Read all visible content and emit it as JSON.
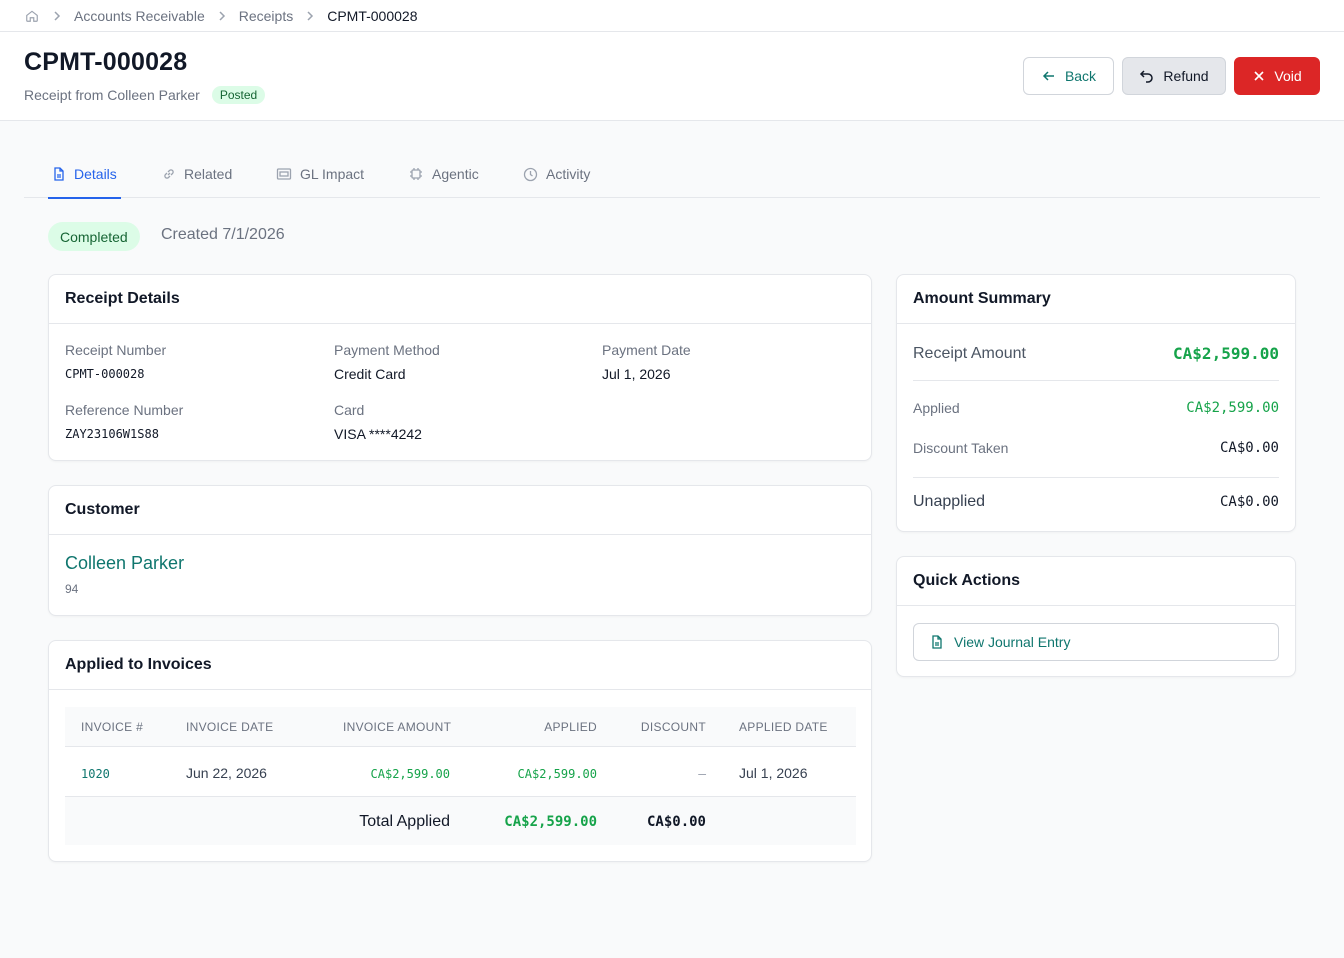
{
  "breadcrumb": {
    "items": [
      "Accounts Receivable",
      "Receipts"
    ],
    "current": "CPMT-000028"
  },
  "header": {
    "title": "CPMT-000028",
    "subtitle": "Receipt from Colleen Parker",
    "badge": "Posted",
    "back_label": "Back",
    "refund_label": "Refund",
    "void_label": "Void"
  },
  "tabs": [
    {
      "label": "Details",
      "icon": "document-icon",
      "active": true
    },
    {
      "label": "Related",
      "icon": "link-icon"
    },
    {
      "label": "GL Impact",
      "icon": "ledger-icon"
    },
    {
      "label": "Agentic",
      "icon": "chip-icon"
    },
    {
      "label": "Activity",
      "icon": "clock-icon"
    }
  ],
  "status": {
    "pill": "Completed",
    "created": "Created 7/1/2026"
  },
  "receipt_details": {
    "title": "Receipt Details",
    "receipt_number_label": "Receipt Number",
    "receipt_number": "CPMT-000028",
    "payment_method_label": "Payment Method",
    "payment_method": "Credit Card",
    "payment_date_label": "Payment Date",
    "payment_date": "Jul 1, 2026",
    "reference_number_label": "Reference Number",
    "reference_number": "ZAY23106W1S88",
    "card_label": "Card",
    "card": "VISA ****4242"
  },
  "customer": {
    "title": "Customer",
    "name": "Colleen Parker",
    "id": "94"
  },
  "applied": {
    "title": "Applied to Invoices",
    "columns": [
      "INVOICE #",
      "INVOICE DATE",
      "INVOICE AMOUNT",
      "APPLIED",
      "DISCOUNT",
      "APPLIED DATE"
    ],
    "rows": [
      {
        "invoice": "1020",
        "invoice_date": "Jun 22, 2026",
        "invoice_amount": "CA$2,599.00",
        "applied": "CA$2,599.00",
        "discount": "–",
        "applied_date": "Jul 1, 2026"
      }
    ],
    "total_label": "Total Applied",
    "total_applied": "CA$2,599.00",
    "total_discount": "CA$0.00"
  },
  "amount_summary": {
    "title": "Amount Summary",
    "receipt_amount_label": "Receipt Amount",
    "receipt_amount": "CA$2,599.00",
    "applied_label": "Applied",
    "applied": "CA$2,599.00",
    "discount_label": "Discount Taken",
    "discount": "CA$0.00",
    "unapplied_label": "Unapplied",
    "unapplied": "CA$0.00"
  },
  "quick_actions": {
    "title": "Quick Actions",
    "view_journal": "View Journal Entry"
  },
  "colors": {
    "accent_teal": "#0f766e",
    "tab_active": "#2563eb",
    "void_red": "#dc2626",
    "money_green": "#16a34a"
  }
}
